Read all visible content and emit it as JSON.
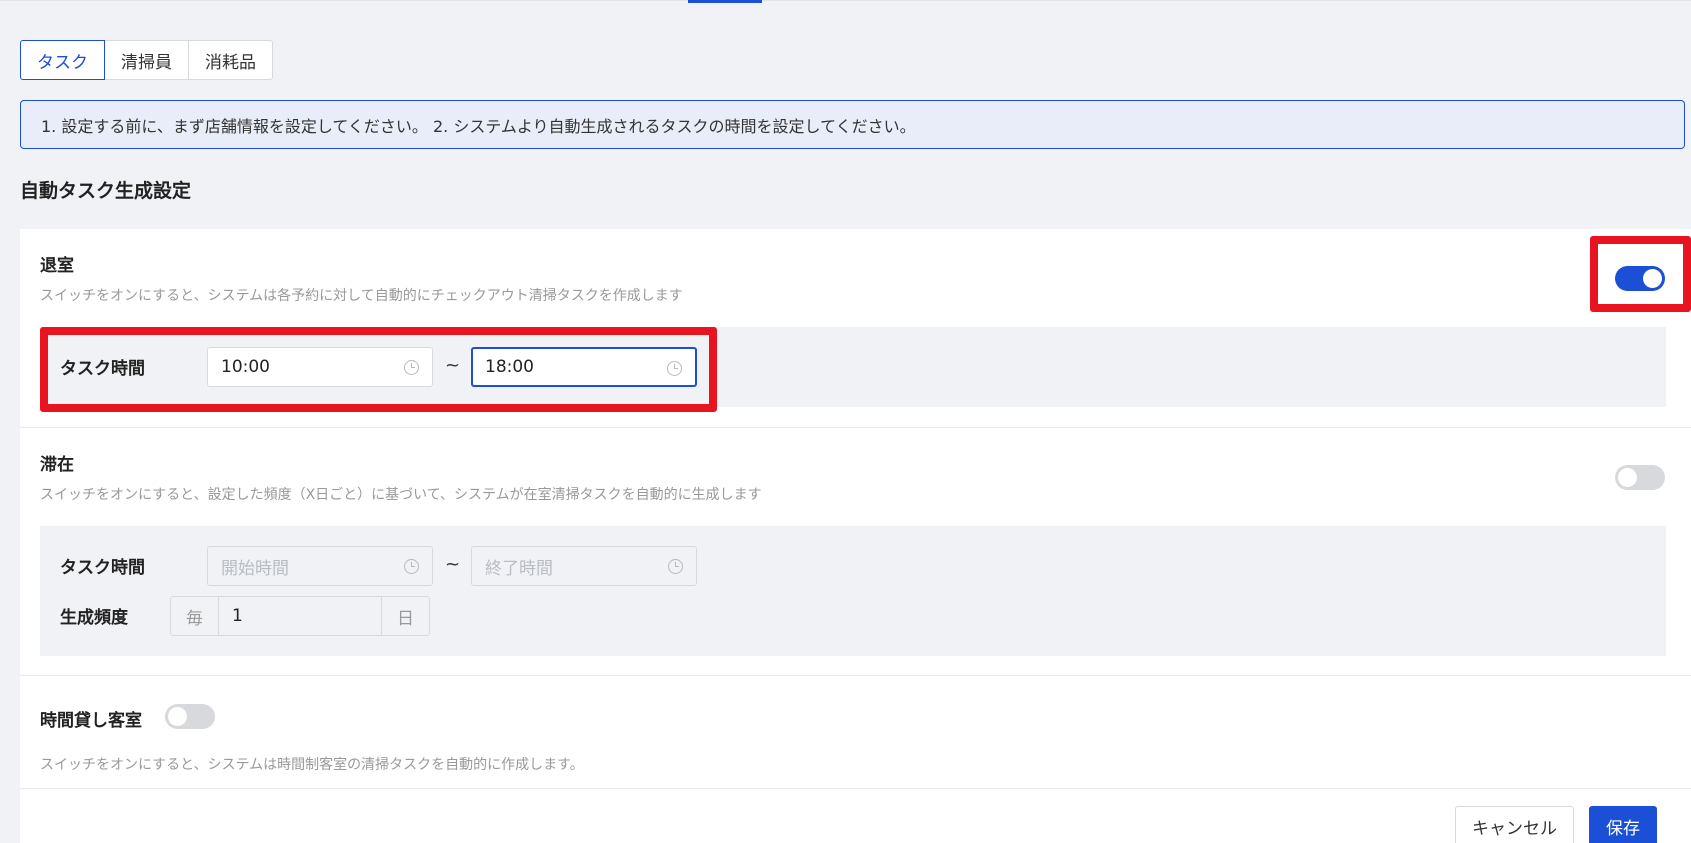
{
  "tabs": [
    {
      "label": "タスク",
      "active": true
    },
    {
      "label": "清掃員",
      "active": false
    },
    {
      "label": "消耗品",
      "active": false
    }
  ],
  "info_banner": "1. 設定する前に、まず店舗情報を設定してください。 2. システムより自動生成されるタスクの時間を設定してください。",
  "section_title": "自動タスク生成設定",
  "checkout": {
    "title": "退室",
    "description": "スイッチをオンにすると、システムは各予約に対して自動的にチェックアウト清掃タスクを作成します",
    "enabled": true,
    "task_time_label": "タスク時間",
    "start_time": "10:00",
    "end_time": "18:00",
    "separator": "~"
  },
  "stay": {
    "title": "滞在",
    "description": "スイッチをオンにすると、設定した頻度（X日ごと）に基づいて、システムが在室清掃タスクを自動的に生成します",
    "enabled": false,
    "task_time_label": "タスク時間",
    "start_placeholder": "開始時間",
    "end_placeholder": "終了時間",
    "separator": "~",
    "frequency_label": "生成頻度",
    "frequency_prefix": "毎",
    "frequency_value": "1",
    "frequency_suffix": "日"
  },
  "hourly": {
    "title": "時間貸し客室",
    "description": "スイッチをオンにすると、システムは時間制客室の清掃タスクを自動的に作成します。",
    "enabled": false
  },
  "buttons": {
    "cancel": "キャンセル",
    "save": "保存"
  },
  "colors": {
    "accent": "#1a4fd6",
    "highlight": "#e8141f"
  }
}
